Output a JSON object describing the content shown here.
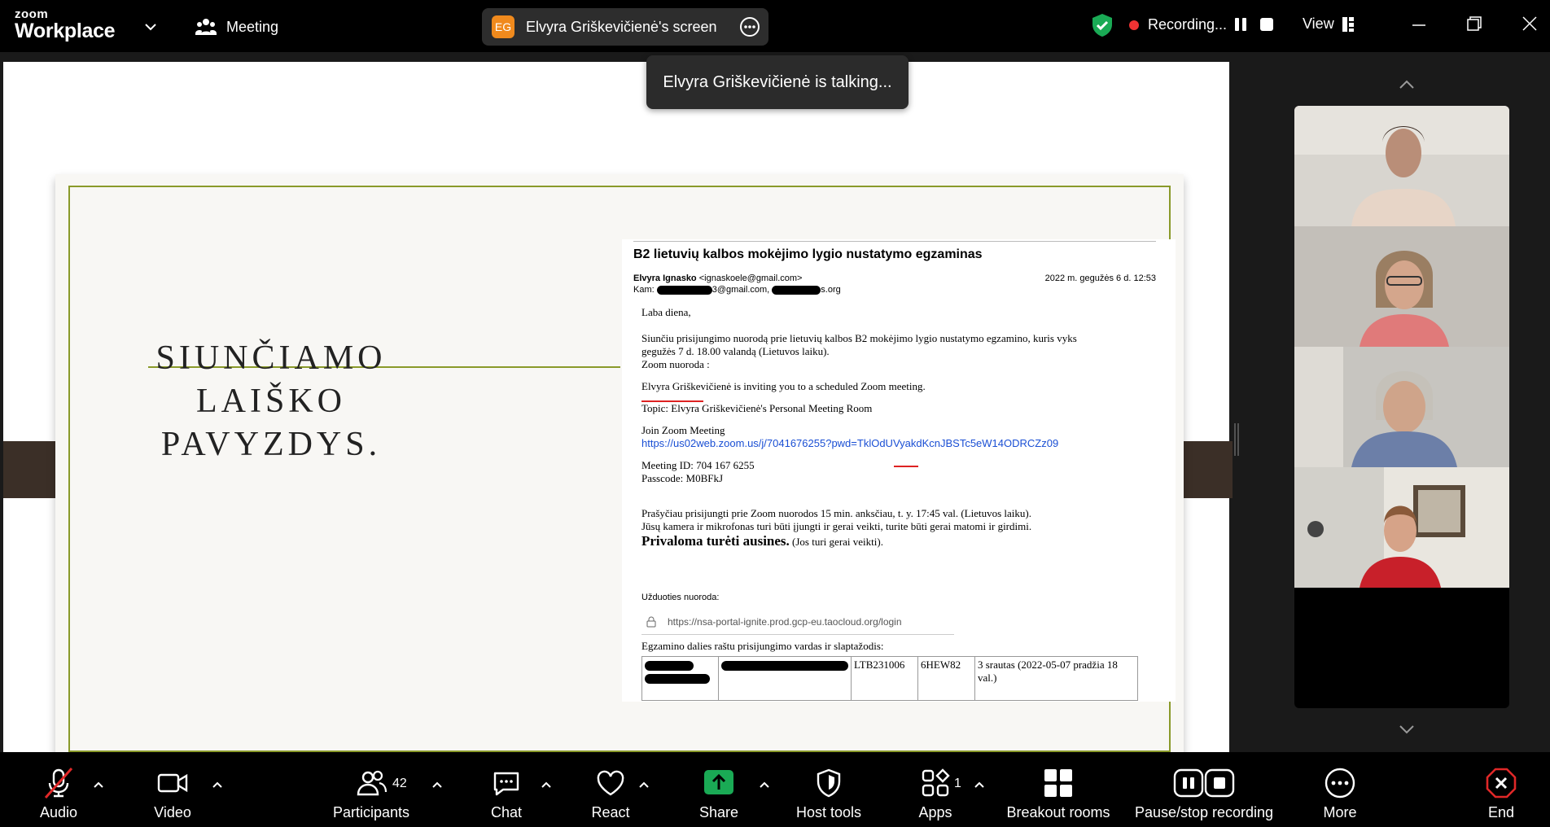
{
  "titlebar": {
    "logo_top": "zoom",
    "logo_bottom": "Workplace",
    "meeting_label": "Meeting",
    "screen_owner_initials": "EG",
    "screen_label": "Elvyra Griškevičienė's screen",
    "recording_label": "Recording...",
    "view_label": "View"
  },
  "notification": {
    "talking": "Elvyra Griškevičienė is talking..."
  },
  "slide": {
    "title_lines": [
      "SIUNČIAMO",
      "LAIŠKO",
      "PAVYZDYS."
    ]
  },
  "email": {
    "subject": "B2 lietuvių kalbos mokėjimo lygio nustatymo egzaminas",
    "from_name": "Elvyra Ignasko",
    "from_addr": "<ignaskoele@gmail.com>",
    "date": "2022 m. gegužės 6 d. 12:53",
    "to_label": "Kam:",
    "to_part1": "3@gmail.com,",
    "to_part2": "s.org",
    "greeting": "Laba diena,",
    "p1_line1": "Siunčiu prisijungimo nuorodą prie lietuvių kalbos B2 mokėjimo lygio nustatymo egzamino, kuris vyks",
    "p1_line2": "gegužės 7 d. 18.00 valandą (Lietuvos laiku).",
    "p1_line3": "Zoom nuoroda :",
    "invite": "Elvyra Griškevičienė is inviting you to a scheduled Zoom meeting.",
    "topic": "Topic: Elvyra Griškevičienė's Personal Meeting Room",
    "join_label": "Join Zoom Meeting",
    "join_url": "https://us02web.zoom.us/j/7041676255?pwd=TklOdUVyakdKcnJBSTc5eW14ODRCZz09",
    "meeting_id": "Meeting ID: 704 167 6255",
    "passcode": "Passcode: M0BFkJ",
    "p2_line1": "Prašyčiau  prisijungti prie Zoom nuorodos 15 min. anksčiau, t. y. 17:45 val. (Lietuvos laiku).",
    "p2_line2": "Jūsų kamera ir mikrofonas turi būti įjungti ir gerai veikti, turite būti gerai matomi ir girdimi.",
    "must_strong": "Privaloma turėti ausines.",
    "must_note": "(Jos turi gerai veikti).",
    "task_label": "Užduoties nuoroda:",
    "task_url": "https://nsa-portal-ignite.prod.gcp-eu.taocloud.org/login",
    "exam_label": "Egzamino dalies raštu prisijungimo vardas ir slaptažodis:",
    "table_row": [
      "",
      "",
      "LTB231006",
      "6HEW82",
      "3 srautas (2022-05-07 pradžia 18 val.)"
    ]
  },
  "toolbar": {
    "audio": "Audio",
    "video": "Video",
    "participants": "Participants",
    "participants_count": "42",
    "chat": "Chat",
    "react": "React",
    "share": "Share",
    "host_tools": "Host tools",
    "apps": "Apps",
    "apps_count": "1",
    "breakout": "Breakout rooms",
    "pause_rec": "Pause/stop recording",
    "more": "More",
    "end": "End"
  },
  "colors": {
    "share_green": "#1aaa55",
    "end_red": "#e02828",
    "link_blue": "#1a4fd4",
    "slide_accent": "#8a9a2a",
    "avatar_orange": "#f08a1d"
  },
  "icons": [
    "chevron-down-icon",
    "meeting-icon",
    "more-icon",
    "shield-check-icon",
    "recording-dot-icon",
    "pause-icon",
    "stop-icon",
    "view-grid-icon",
    "minimize-icon",
    "maximize-icon",
    "close-icon",
    "edit-icon",
    "chevron-up-icon",
    "mic-muted-icon",
    "video-icon",
    "participants-icon",
    "chat-icon",
    "react-heart-icon",
    "share-arrow-icon",
    "host-shield-icon",
    "apps-icon",
    "breakout-icon",
    "pause-stop-icon",
    "more-dots-icon",
    "end-icon",
    "lock-icon"
  ]
}
